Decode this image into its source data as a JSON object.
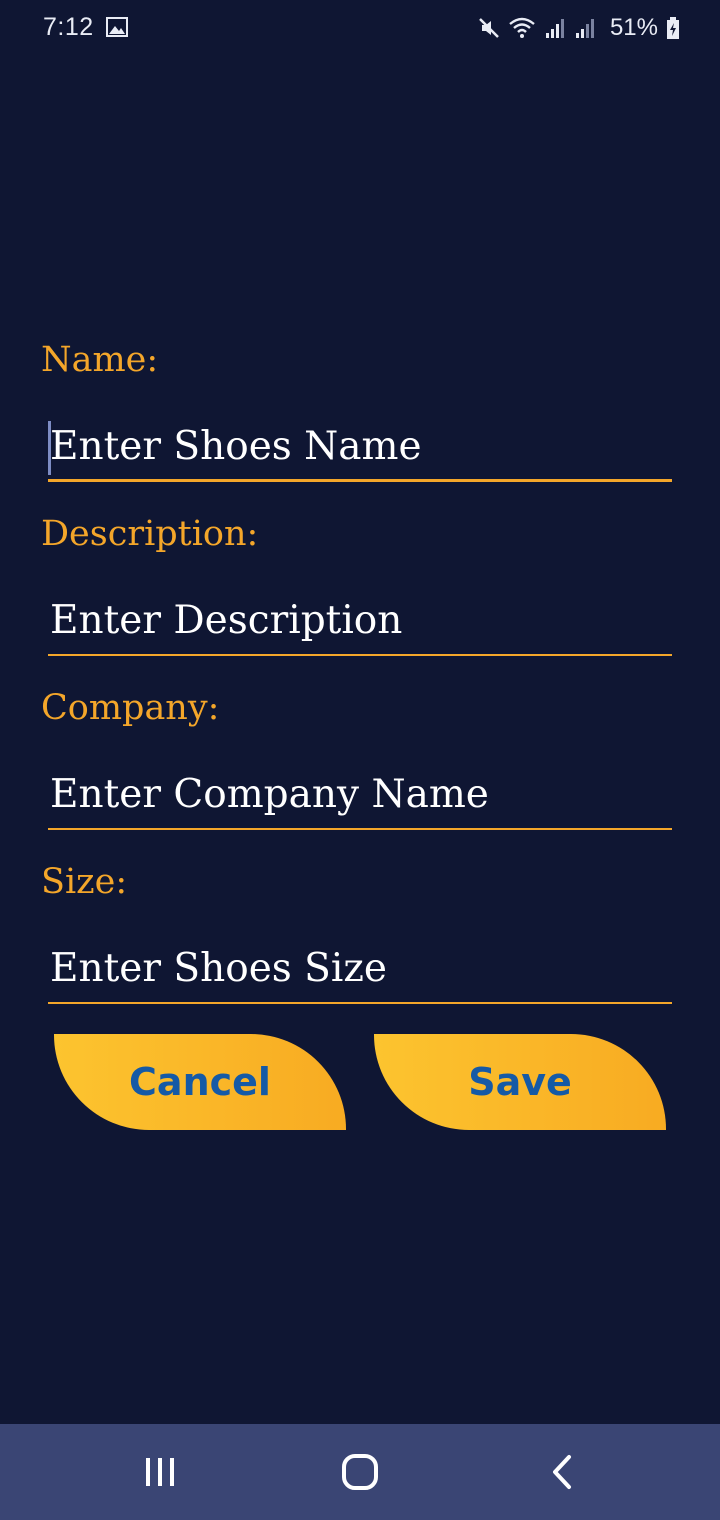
{
  "status_bar": {
    "time": "7:12",
    "battery": "51%",
    "icons": [
      "gallery-icon",
      "mute-icon",
      "wifi-icon",
      "signal-icon",
      "signal-icon-2",
      "battery-icon"
    ]
  },
  "form": {
    "fields": [
      {
        "label": "Name:",
        "placeholder": "Enter Shoes Name"
      },
      {
        "label": "Description:",
        "placeholder": "Enter Description"
      },
      {
        "label": "Company:",
        "placeholder": "Enter Company Name"
      },
      {
        "label": "Size:",
        "placeholder": "Enter Shoes Size"
      }
    ]
  },
  "buttons": {
    "cancel": "Cancel",
    "save": "Save"
  },
  "colors": {
    "background": "#0f1633",
    "accent": "#f4a62a",
    "button_text": "#155aa6",
    "nav_bar": "#3a4574"
  },
  "nav": {
    "items": [
      "recent-apps-icon",
      "home-icon",
      "back-icon"
    ]
  }
}
